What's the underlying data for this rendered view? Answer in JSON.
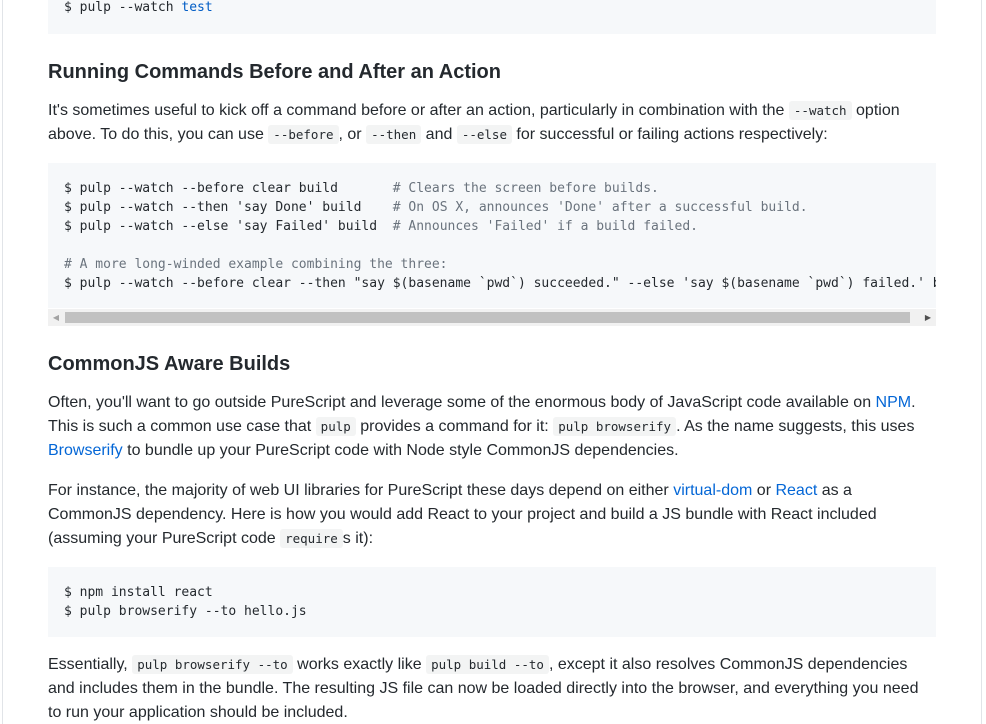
{
  "top_code": {
    "prompt": "$ pulp --watch ",
    "arg": "test"
  },
  "section1": {
    "heading": "Running Commands Before and After an Action",
    "p1_a": "It's sometimes useful to kick off a command before or after an action, particularly in combination with the ",
    "p1_code1": "--watch",
    "p1_b": " option above. To do this, you can use ",
    "p1_code2": "--before",
    "p1_c": ", or ",
    "p1_code3": "--then",
    "p1_d": " and ",
    "p1_code4": "--else",
    "p1_e": " for successful or failing actions respectively:",
    "code_lines": [
      {
        "cmd": "$ pulp --watch --before clear build       ",
        "comment": "# Clears the screen before builds."
      },
      {
        "cmd": "$ pulp --watch --then 'say Done' build    ",
        "comment": "# On OS X, announces 'Done' after a successful build."
      },
      {
        "cmd": "$ pulp --watch --else 'say Failed' build  ",
        "comment": "# Announces 'Failed' if a build failed."
      },
      {
        "cmd": "",
        "comment": ""
      },
      {
        "cmd": "",
        "comment": "# A more long-winded example combining the three:"
      },
      {
        "cmd": "$ pulp --watch --before clear --then \"say $(basename `pwd`) succeeded.\" --else 'say $(basename `pwd`) failed.' build",
        "comment": ""
      }
    ]
  },
  "section2": {
    "heading": "CommonJS Aware Builds",
    "p1_a": "Often, you'll want to go outside PureScript and leverage some of the enormous body of JavaScript code available on ",
    "p1_link1": "NPM",
    "p1_b": ". This is such a common use case that ",
    "p1_code1": "pulp",
    "p1_c": " provides a command for it: ",
    "p1_code2": "pulp browserify",
    "p1_d": ". As the name suggests, this uses ",
    "p1_link2": "Browserify",
    "p1_e": " to bundle up your PureScript code with Node style CommonJS dependencies.",
    "p2_a": "For instance, the majority of web UI libraries for PureScript these days depend on either ",
    "p2_link1": "virtual-dom",
    "p2_b": " or ",
    "p2_link2": "React",
    "p2_c": " as a CommonJS dependency. Here is how you would add React to your project and build a JS bundle with React included (assuming your PureScript code ",
    "p2_code1": "require",
    "p2_d": "s it):",
    "code_lines": [
      "$ npm install react",
      "$ pulp browserify --to hello.js"
    ],
    "p3_a": "Essentially, ",
    "p3_code1": "pulp browserify --to",
    "p3_b": " works exactly like ",
    "p3_code2": "pulp build --to",
    "p3_c": ", except it also resolves CommonJS dependencies and includes them in the bundle. The resulting JS file can now be loaded directly into the browser, and everything you need to run your application should be included."
  },
  "scrollbar": {
    "left_arrow": "◀",
    "right_arrow": "▶"
  }
}
